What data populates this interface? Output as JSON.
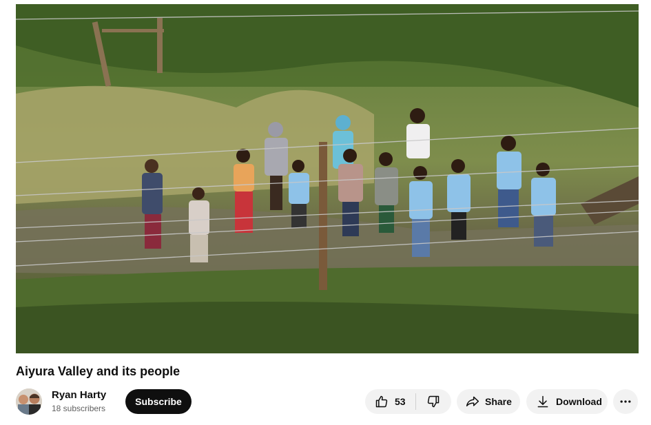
{
  "video": {
    "title": "Aiyura Valley and its people",
    "thumbnail_description_icon": "video-frame"
  },
  "channel": {
    "name": "Ryan Harty",
    "subscribers": "18 subscribers",
    "subscribe_label": "Subscribe"
  },
  "actions": {
    "like_count": "53",
    "share_label": "Share",
    "download_label": "Download"
  },
  "icons": {
    "like": "thumbs-up-icon",
    "dislike": "thumbs-down-icon",
    "share": "share-arrow-icon",
    "download": "download-icon",
    "more": "more-horizontal-icon"
  },
  "colors": {
    "subscribe_bg": "#0f0f0f",
    "pill_bg": "#f2f2f2",
    "secondary_text": "#606060"
  }
}
